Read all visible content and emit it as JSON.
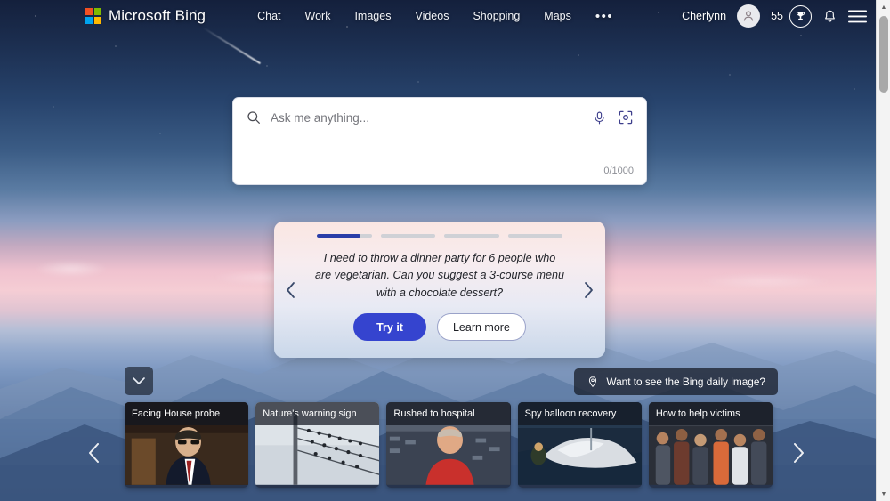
{
  "brand": {
    "name": "Microsoft Bing",
    "logo_colors": [
      "#f25022",
      "#7fba00",
      "#00a4ef",
      "#ffb900"
    ]
  },
  "nav": {
    "items": [
      {
        "label": "Chat"
      },
      {
        "label": "Work"
      },
      {
        "label": "Images"
      },
      {
        "label": "Videos"
      },
      {
        "label": "Shopping"
      },
      {
        "label": "Maps"
      }
    ],
    "more_label": "•••"
  },
  "account": {
    "user_name": "Cherlynn",
    "avatar_icon": "person-icon",
    "rewards_count": "55",
    "rewards_icon": "trophy-icon",
    "notifications_icon": "bell-icon",
    "menu_icon": "hamburger-menu-icon"
  },
  "search": {
    "placeholder": "Ask me anything...",
    "value": "",
    "counter": "0/1000",
    "search_icon": "search-icon",
    "mic_icon": "microphone-icon",
    "visual_icon": "visual-search-icon"
  },
  "suggestion": {
    "text": "I need to throw a dinner party for 6 people who are vegetarian. Can you suggest a 3-course menu with a chocolate dessert?",
    "try_label": "Try it",
    "learn_label": "Learn more",
    "prev_icon": "chevron-left-icon",
    "next_icon": "chevron-right-icon",
    "progress_total": 4,
    "progress_active_index": 0,
    "progress_active_percent": 80,
    "accent_color": "#3544cf",
    "progress_fill_color": "#2a3ea8"
  },
  "daily_image": {
    "label": "Want to see the Bing daily image?",
    "icon": "location-pin-icon"
  },
  "collapse": {
    "icon": "chevron-down-icon"
  },
  "news": {
    "prev_icon": "chevron-left-icon",
    "next_icon": "chevron-right-icon",
    "cards": [
      {
        "title": "Facing House probe"
      },
      {
        "title": "Nature's warning sign"
      },
      {
        "title": "Rushed to hospital"
      },
      {
        "title": "Spy balloon recovery"
      },
      {
        "title": "How to help victims"
      }
    ]
  },
  "scrollbar": {
    "up_arrow": "▲",
    "down_arrow": "▼"
  }
}
